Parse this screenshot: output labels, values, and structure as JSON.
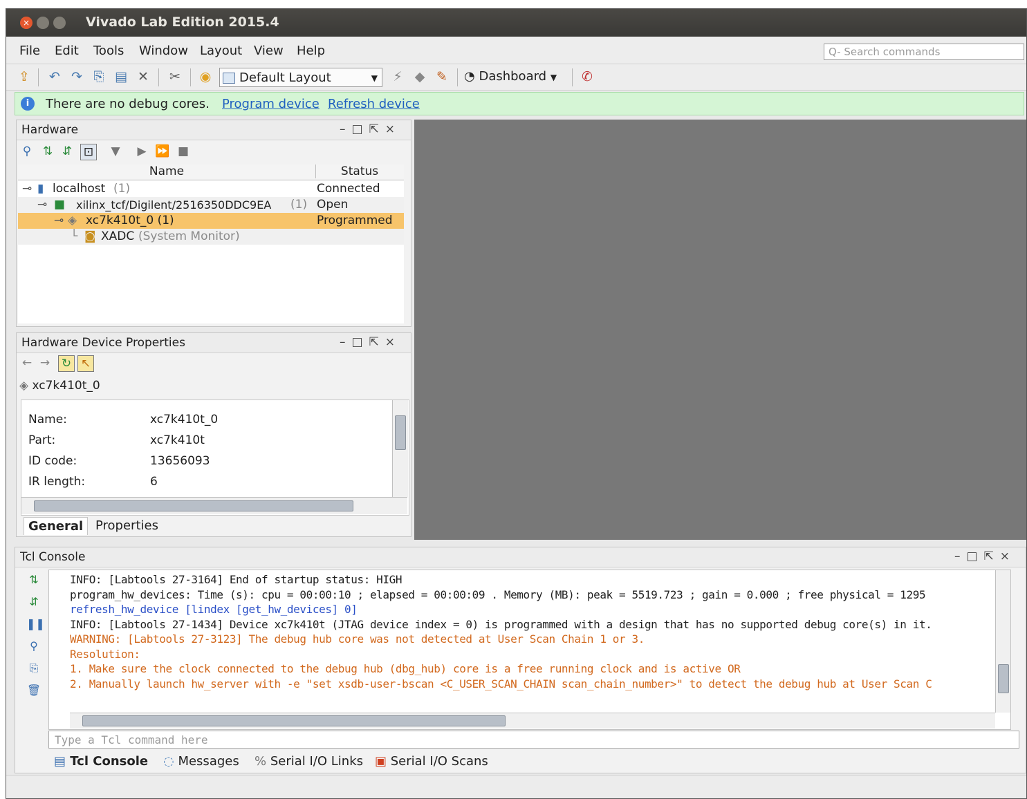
{
  "window": {
    "title": "Vivado Lab Edition 2015.4"
  },
  "menu": {
    "items": [
      "File",
      "Edit",
      "Tools",
      "Window",
      "Layout",
      "View",
      "Help"
    ],
    "search_placeholder": "Q- Search commands"
  },
  "toolbar": {
    "layout_value": "Default Layout",
    "dashboard_label": "Dashboard"
  },
  "banner": {
    "message": "There are no debug cores.",
    "program_link": "Program device",
    "refresh_link": "Refresh device"
  },
  "hardware": {
    "title": "Hardware",
    "columns": [
      "Name",
      "Status"
    ],
    "rows": [
      {
        "name": "localhost",
        "count": "(1)",
        "status": "Connected"
      },
      {
        "name": "xilinx_tcf/Digilent/2516350DDC9EA",
        "count": "(1)",
        "status": "Open"
      },
      {
        "name": "xc7k410t_0 (1)",
        "count": "",
        "status": "Programmed"
      },
      {
        "name": "XADC",
        "count": "(System Monitor)",
        "status": ""
      }
    ]
  },
  "device_props": {
    "title": "Hardware Device Properties",
    "device": "xc7k410t_0",
    "fields": [
      {
        "label": "Name:",
        "value": "xc7k410t_0"
      },
      {
        "label": "Part:",
        "value": "xc7k410t"
      },
      {
        "label": "ID code:",
        "value": "13656093"
      },
      {
        "label": "IR length:",
        "value": "6"
      }
    ],
    "tabs": [
      "General",
      "Properties"
    ]
  },
  "console": {
    "title": "Tcl Console",
    "lines": [
      {
        "kind": "info",
        "text": "INFO: [Labtools 27-3164] End of startup status: HIGH"
      },
      {
        "kind": "info",
        "text": "program_hw_devices: Time (s): cpu = 00:00:10 ; elapsed = 00:00:09 . Memory (MB): peak = 5519.723 ; gain = 0.000 ; free physical = 1295"
      },
      {
        "kind": "cmd",
        "text": "refresh_hw_device [lindex [get_hw_devices] 0]"
      },
      {
        "kind": "info",
        "text": "INFO: [Labtools 27-1434] Device xc7k410t (JTAG device index = 0) is programmed with a design that has no supported debug core(s) in it."
      },
      {
        "kind": "warn",
        "text": "WARNING: [Labtools 27-3123] The debug hub core was not detected at User Scan Chain 1 or 3."
      },
      {
        "kind": "warn",
        "text": "Resolution:"
      },
      {
        "kind": "warn",
        "text": "1. Make sure the clock connected to the debug hub (dbg_hub) core is a free running clock and is active OR"
      },
      {
        "kind": "warn",
        "text": "2. Manually launch hw_server with -e \"set xsdb-user-bscan <C_USER_SCAN_CHAIN scan_chain_number>\" to detect the debug hub at User Scan C"
      }
    ],
    "input_placeholder": "Type a Tcl command here",
    "tabs": [
      "Tcl Console",
      "Messages",
      "Serial I/O Links",
      "Serial I/O Scans"
    ]
  }
}
